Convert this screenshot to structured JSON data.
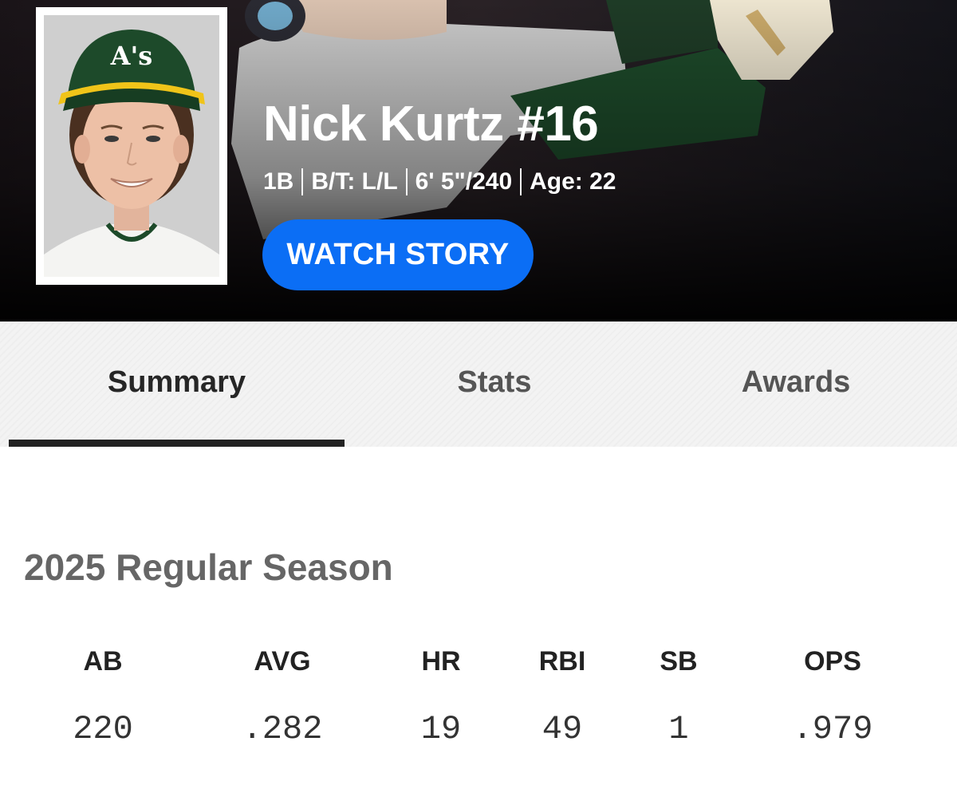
{
  "player": {
    "name": "Nick Kurtz #16",
    "position": "1B",
    "bats_throws": "B/T: L/L",
    "height_weight": "6' 5\"/240",
    "age": "Age: 22"
  },
  "hero": {
    "watch_button_label": "WATCH STORY",
    "accent_color": "#0b6ef5"
  },
  "tabs": [
    {
      "label": "Summary",
      "active": true
    },
    {
      "label": "Stats",
      "active": false
    },
    {
      "label": "Awards",
      "active": false
    }
  ],
  "season": {
    "title": "2025 Regular Season",
    "stats": [
      {
        "label": "AB",
        "value": "220"
      },
      {
        "label": "AVG",
        "value": ".282"
      },
      {
        "label": "HR",
        "value": "19"
      },
      {
        "label": "RBI",
        "value": "49"
      },
      {
        "label": "SB",
        "value": "1"
      },
      {
        "label": "OPS",
        "value": ".979"
      }
    ]
  }
}
